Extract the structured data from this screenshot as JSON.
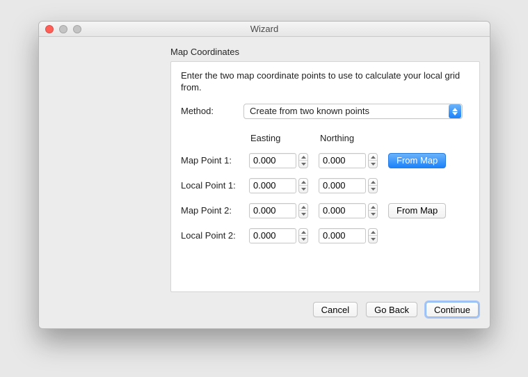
{
  "window": {
    "title": "Wizard"
  },
  "section": {
    "title": "Map Coordinates"
  },
  "instructions": "Enter the two map coordinate points to use to calculate your local grid from.",
  "method": {
    "label": "Method:",
    "selected": "Create from two known points"
  },
  "columns": {
    "easting": "Easting",
    "northing": "Northing"
  },
  "rows": {
    "map1": {
      "label": "Map Point 1:",
      "easting": "0.000",
      "northing": "0.000",
      "button": "From Map"
    },
    "local1": {
      "label": "Local Point 1:",
      "easting": "0.000",
      "northing": "0.000"
    },
    "map2": {
      "label": "Map Point 2:",
      "easting": "0.000",
      "northing": "0.000",
      "button": "From Map"
    },
    "local2": {
      "label": "Local Point 2:",
      "easting": "0.000",
      "northing": "0.000"
    }
  },
  "footer": {
    "cancel": "Cancel",
    "goback": "Go Back",
    "continue": "Continue"
  }
}
